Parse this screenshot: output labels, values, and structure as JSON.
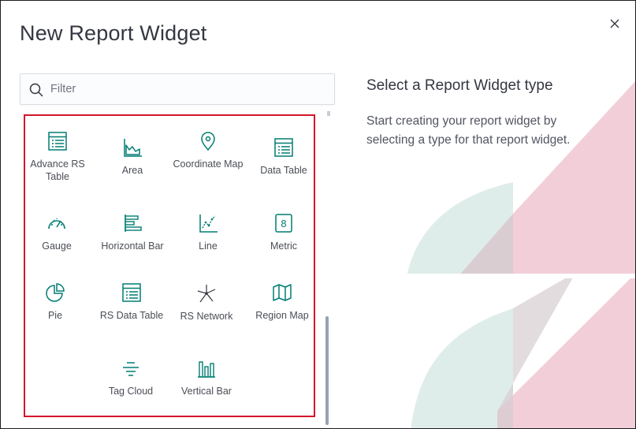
{
  "dialog": {
    "title": "New Report Widget",
    "close_icon": "close-icon"
  },
  "search": {
    "placeholder": "Filter",
    "value": "",
    "icon": "search-icon"
  },
  "widgets": [
    {
      "label": "Advance RS Table",
      "icon": "table-icon"
    },
    {
      "label": "Area",
      "icon": "area-chart-icon"
    },
    {
      "label": "Coordinate Map",
      "icon": "map-pin-icon"
    },
    {
      "label": "Data Table",
      "icon": "table-icon"
    },
    {
      "label": "Gauge",
      "icon": "gauge-icon"
    },
    {
      "label": "Horizontal Bar",
      "icon": "horizontal-bar-icon"
    },
    {
      "label": "Line",
      "icon": "line-chart-icon"
    },
    {
      "label": "Metric",
      "icon": "metric-icon"
    },
    {
      "label": "Pie",
      "icon": "pie-chart-icon"
    },
    {
      "label": "RS Data Table",
      "icon": "table-icon"
    },
    {
      "label": "RS Network",
      "icon": "network-icon"
    },
    {
      "label": "Region Map",
      "icon": "region-map-icon"
    },
    {
      "label": "Tag Cloud",
      "icon": "tag-cloud-icon"
    },
    {
      "label": "Vertical Bar",
      "icon": "vertical-bar-icon"
    }
  ],
  "panel": {
    "heading": "Select a Report Widget type",
    "description": "Start creating your report widget by selecting a type for that report widget."
  },
  "colors": {
    "icon": "#017d73",
    "highlight_border": "#d5152a",
    "illustration_pink": "#f0c7d1",
    "illustration_teal": "#dcebe8"
  }
}
